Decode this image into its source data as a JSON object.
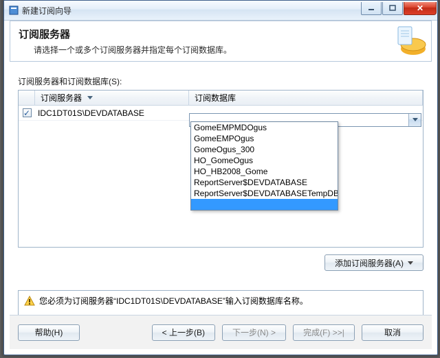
{
  "window": {
    "title": "新建订阅向导"
  },
  "header": {
    "title": "订阅服务器",
    "subtitle": "请选择一个或多个订阅服务器并指定每个订阅数据库。"
  },
  "section_label": "订阅服务器和订阅数据库(S):",
  "grid": {
    "col_server": "订阅服务器",
    "col_database": "订阅数据库",
    "rows": [
      {
        "checked": true,
        "server": "IDC1DT01S\\DEVDATABASE",
        "database": ""
      }
    ]
  },
  "dropdown_options": [
    "GomeEMPMDOgus",
    "GomeEMPOgus",
    "GomeOgus_300",
    "HO_GomeOgus",
    "HO_HB2008_Gome",
    "ReportServer$DEVDATABASE",
    "ReportServer$DEVDATABASETempDB"
  ],
  "buttons": {
    "add_server": "添加订阅服务器(A)",
    "help": "帮助(H)",
    "back": "< 上一步(B)",
    "next": "下一步(N) >",
    "finish": "完成(F) >>|",
    "cancel": "取消"
  },
  "warning": "您必须为订阅服务器“IDC1DT01S\\DEVDATABASE”输入订阅数据库名称。"
}
